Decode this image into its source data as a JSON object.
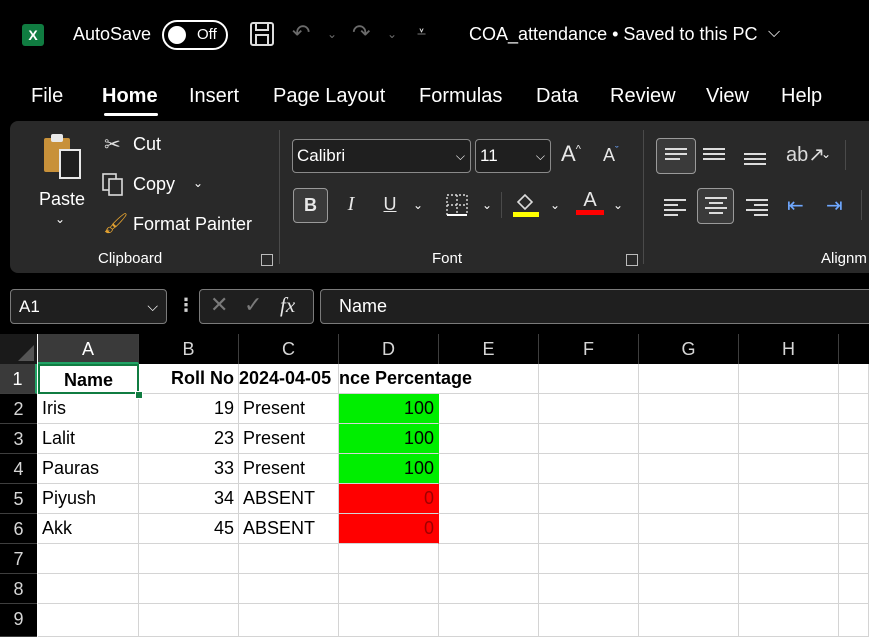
{
  "titlebar": {
    "autosave_label": "AutoSave",
    "toggle_state": "Off",
    "file_title": "COA_attendance • Saved to this PC"
  },
  "menu": [
    "File",
    "Home",
    "Insert",
    "Page Layout",
    "Formulas",
    "Data",
    "Review",
    "View",
    "Help"
  ],
  "ribbon": {
    "clipboard": {
      "paste": "Paste",
      "cut": "Cut",
      "copy": "Copy",
      "format_painter": "Format Painter",
      "label": "Clipboard"
    },
    "font": {
      "font_name": "Calibri",
      "font_size": "11",
      "bold": "B",
      "italic": "I",
      "underline": "U",
      "label": "Font"
    },
    "alignment": {
      "label": "Alignm"
    }
  },
  "formula_bar": {
    "name_box": "A1",
    "fx": "fx",
    "content": "Name"
  },
  "sheet": {
    "columns": [
      "A",
      "B",
      "C",
      "D",
      "E",
      "F",
      "G",
      "H"
    ],
    "rows": [
      "1",
      "2",
      "3",
      "4",
      "5",
      "6",
      "7",
      "8",
      "9"
    ],
    "header": {
      "a": "Name",
      "b": "Roll No",
      "c": "2024-04-05",
      "d": "Attendance Percentage",
      "d_visible": "nce Percentage"
    },
    "data": [
      {
        "name": "Iris",
        "roll": "19",
        "status": "Present",
        "pct": "100"
      },
      {
        "name": "Lalit",
        "roll": "23",
        "status": "Present",
        "pct": "100"
      },
      {
        "name": "Pauras",
        "roll": "33",
        "status": "Present",
        "pct": "100"
      },
      {
        "name": "Piyush",
        "roll": "34",
        "status": "ABSENT",
        "pct": "0"
      },
      {
        "name": "Akk",
        "roll": "45",
        "status": "ABSENT",
        "pct": "0"
      }
    ]
  },
  "colors": {
    "present_fill": "#00ee00",
    "absent_fill": "#ff0000",
    "excel_green": "#107c41"
  }
}
